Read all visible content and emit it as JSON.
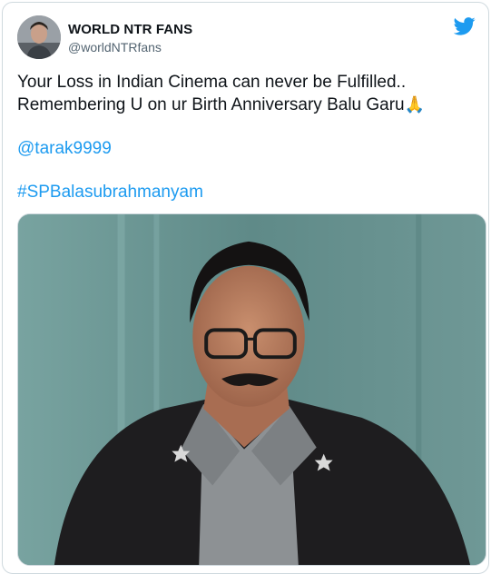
{
  "tweet": {
    "author": {
      "display_name": "WORLD NTR FANS",
      "handle": "@worldNTRfans",
      "avatar_icon": "profile-photo-icon"
    },
    "logo_icon": "twitter-bird-icon",
    "brand_color": "#1d9bf0",
    "text_line_1": "Your Loss in Indian Cinema can never be Fulfilled..",
    "text_line_2": "Remembering U on ur Birth Anniversary Balu Garu",
    "emoji": "🙏",
    "mention": "@tarak9999",
    "hashtag": "#SPBalasubrahmanyam",
    "media": {
      "type": "photo",
      "icon": "portrait-photo-icon"
    }
  }
}
